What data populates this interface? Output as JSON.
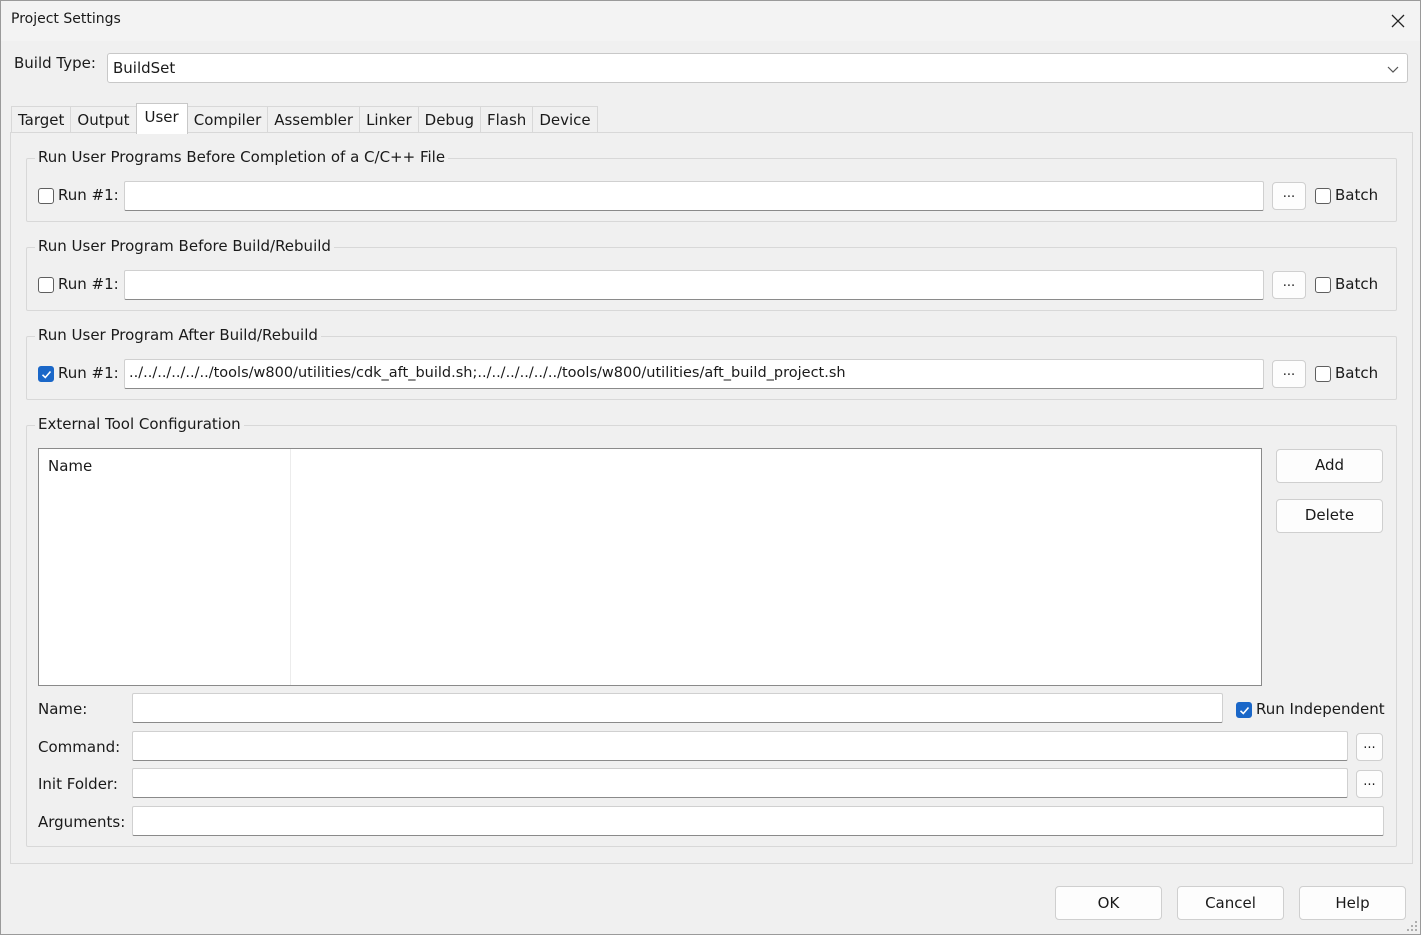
{
  "window": {
    "title": "Project Settings"
  },
  "build_type": {
    "label": "Build Type:",
    "value": "BuildSet"
  },
  "tabs": [
    {
      "label": "Target"
    },
    {
      "label": "Output"
    },
    {
      "label": "User",
      "active": true
    },
    {
      "label": "Compiler"
    },
    {
      "label": "Assembler"
    },
    {
      "label": "Linker"
    },
    {
      "label": "Debug"
    },
    {
      "label": "Flash"
    },
    {
      "label": "Device"
    }
  ],
  "groups": {
    "before_compile": {
      "title": "Run User Programs Before Completion of a C/C++ File",
      "run_label": "Run #1:",
      "run_checked": false,
      "command": "",
      "browse": "...",
      "batch_label": "Batch",
      "batch_checked": false
    },
    "before_build": {
      "title": "Run User Program Before Build/Rebuild",
      "run_label": "Run #1:",
      "run_checked": false,
      "command": "",
      "browse": "...",
      "batch_label": "Batch",
      "batch_checked": false
    },
    "after_build": {
      "title": "Run User Program After Build/Rebuild",
      "run_label": "Run #1:",
      "run_checked": true,
      "command": "../../../../../../tools/w800/utilities/cdk_aft_build.sh;../../../../../../tools/w800/utilities/aft_build_project.sh",
      "browse": "...",
      "batch_label": "Batch",
      "batch_checked": false
    }
  },
  "external_tools": {
    "title": "External Tool Configuration",
    "list_header": "Name",
    "add_label": "Add",
    "delete_label": "Delete",
    "name_label": "Name:",
    "name_value": "",
    "run_independent_label": "Run Independent",
    "run_independent_checked": true,
    "command_label": "Command:",
    "command_value": "",
    "init_folder_label": "Init Folder:",
    "init_folder_value": "",
    "arguments_label": "Arguments:",
    "arguments_value": "",
    "browse": "..."
  },
  "footer": {
    "ok_label": "OK",
    "cancel_label": "Cancel",
    "help_label": "Help"
  },
  "colors": {
    "accent": "#1a67c8",
    "dialog_bg": "#f0f0f0",
    "border": "#d8d8d8"
  }
}
